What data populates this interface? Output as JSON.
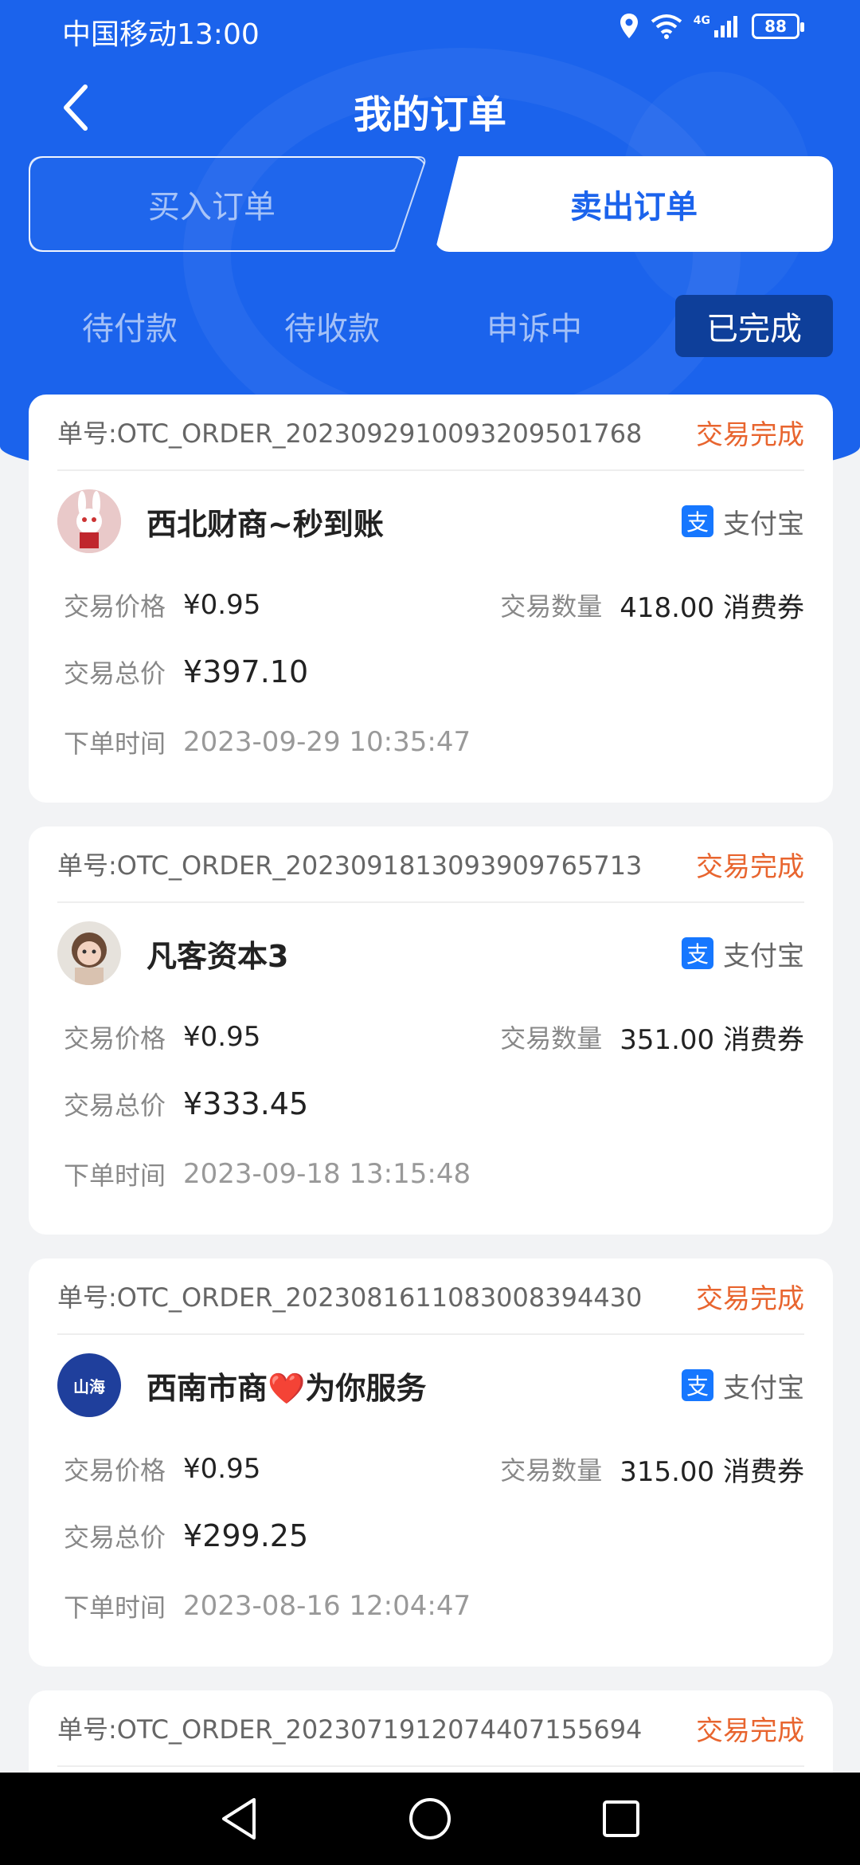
{
  "status_bar": {
    "carrier_time": "中国移动13:00",
    "signal": "4G",
    "battery": "88"
  },
  "nav": {
    "title": "我的订单"
  },
  "segments": {
    "buy": "买入订单",
    "sell": "卖出订单",
    "active": "sell"
  },
  "status_tabs": [
    "待付款",
    "待收款",
    "申诉中",
    "已完成"
  ],
  "active_status_tab": 3,
  "labels": {
    "order_no_prefix": "单号:",
    "price": "交易价格",
    "quantity": "交易数量",
    "total": "交易总价",
    "time": "下单时间",
    "unit": "消费券"
  },
  "orders": [
    {
      "order_no": "单号:OTC_ORDER_20230929100932095​01768",
      "status": "交易完成",
      "merchant": "西北财商~秒到账",
      "payment": "支付宝",
      "price": "¥0.95",
      "quantity": "418.00 消费券",
      "total": "¥397.10",
      "time": "2023-09-29 10:35:47"
    },
    {
      "order_no": "单号:OTC_ORDER_202309181309390976​5713",
      "status": "交易完成",
      "merchant": "凡客资本3",
      "payment": "支付宝",
      "price": "¥0.95",
      "quantity": "351.00 消费券",
      "total": "¥333.45",
      "time": "2023-09-18 13:15:48"
    },
    {
      "order_no": "单号:OTC_ORDER_202308161108300839​4430",
      "status": "交易完成",
      "merchant": "西南市商❤️为你服务",
      "payment": "支付宝",
      "price": "¥0.95",
      "quantity": "315.00 消费券",
      "total": "¥299.25",
      "time": "2023-08-16 12:04:47"
    },
    {
      "order_no": "单号:OTC_ORDER_202307191207440715​5694",
      "status": "交易完成"
    }
  ],
  "avatar_badge_text": "山海"
}
